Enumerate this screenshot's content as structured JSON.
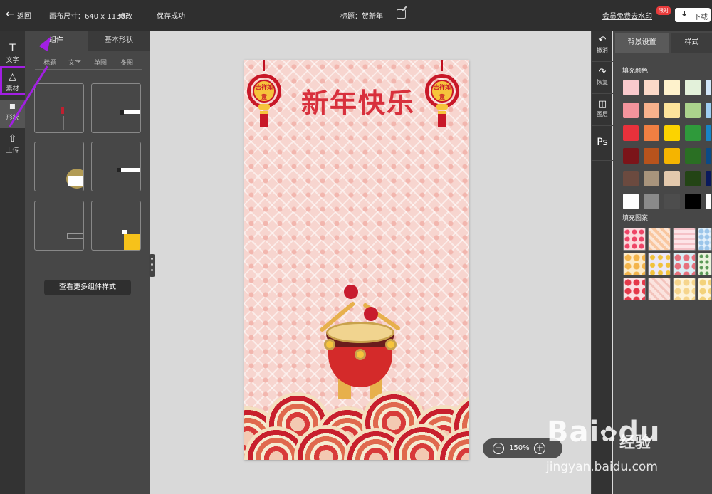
{
  "topbar": {
    "back_label": "返回",
    "canvas_size": "画布尺寸：640 x 1138",
    "modify_label": "修改",
    "save_status": "保存成功",
    "title": "标题：贺新年",
    "vip_link": "会员免费去水印",
    "limited_badge": "限时",
    "download_label": "下载"
  },
  "rail": {
    "items": [
      {
        "label": "文字",
        "icon": "text-icon"
      },
      {
        "label": "素材",
        "icon": "material-icon"
      },
      {
        "label": "形状",
        "icon": "shape-icon"
      },
      {
        "label": "上传",
        "icon": "upload-icon"
      }
    ],
    "highlight_color": "#a21fe3"
  },
  "panel": {
    "tabs": [
      "组件",
      "基本形状"
    ],
    "subtabs": [
      "标题",
      "文字",
      "单图",
      "多图"
    ],
    "more_button": "查看更多组件样式"
  },
  "poster": {
    "headline": "新年快乐",
    "knot_text": "吉祥如意"
  },
  "zoom": {
    "value": "150%"
  },
  "right_tools": [
    {
      "label": "撤消",
      "icon": "undo-icon"
    },
    {
      "label": "恢复",
      "icon": "redo-icon"
    },
    {
      "label": "图层",
      "icon": "layers-icon"
    },
    {
      "label": "",
      "icon": "ps-icon",
      "glyph": "Ps"
    }
  ],
  "right_panel": {
    "tabs": [
      "背景设置",
      "样式"
    ],
    "fill_color_label": "填充颜色",
    "fill_pattern_label": "填充图案",
    "colors": [
      [
        "#f9c9cc",
        "#fbd9c8",
        "#fef2cc",
        "#e3f1da",
        "#d2e6f8"
      ],
      [
        "#f4949c",
        "#f8b28c",
        "#fde49b",
        "#abd38c",
        "#9fcdf1"
      ],
      [
        "#e8313b",
        "#f07f42",
        "#fcd300",
        "#2f9a3b",
        "#1784c7"
      ],
      [
        "#7b1419",
        "#b8531c",
        "#f5b400",
        "#2a6f23",
        "#0b4a86"
      ],
      [
        "#6b4a3f",
        "#a8947c",
        "#e3c9ad",
        "#234415",
        "#0a1a5c"
      ],
      [
        "#ffffff",
        "#8a8a8a",
        "#4d4d4d",
        "#000000",
        "#ffffff"
      ]
    ]
  },
  "watermark": {
    "logo": "Bai",
    "logo_mark": "du",
    "text": "经验",
    "url": "jingyan.baidu.com"
  }
}
